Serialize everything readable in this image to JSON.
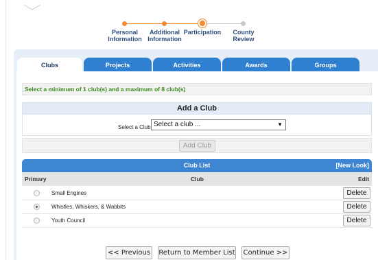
{
  "stepper": {
    "steps": [
      {
        "label_line1": "Personal",
        "label_line2": "Information",
        "state": "done"
      },
      {
        "label_line1": "Additional",
        "label_line2": "Information",
        "state": "done"
      },
      {
        "label_line1": "Participation",
        "label_line2": "",
        "state": "current"
      },
      {
        "label_line1": "County",
        "label_line2": "Review",
        "state": "pending"
      }
    ],
    "colors": {
      "done": "#f28a2e",
      "pending": "#c8c8c8"
    }
  },
  "tabs": [
    {
      "label": "Clubs",
      "active": true
    },
    {
      "label": "Projects",
      "active": false
    },
    {
      "label": "Activities",
      "active": false
    },
    {
      "label": "Awards",
      "active": false
    },
    {
      "label": "Groups",
      "active": false
    }
  ],
  "notice": "Select a minimum of 1 club(s) and a maximum of 8 club(s)",
  "add_club": {
    "title": "Add a Club",
    "select_label": "Select a Club:",
    "select_value": "Select a club ...",
    "button_label": "Add Club"
  },
  "club_list": {
    "title": "Club List",
    "new_look_link": "[New Look]",
    "columns": {
      "primary": "Primary",
      "club": "Club",
      "edit": "Edit"
    },
    "rows": [
      {
        "name": "Small Engines",
        "primary": false,
        "action": "Delete"
      },
      {
        "name": "Whistles, Whiskers, & Wabbits",
        "primary": true,
        "action": "Delete"
      },
      {
        "name": "Youth Council",
        "primary": false,
        "action": "Delete"
      }
    ]
  },
  "footer": {
    "previous": "<< Previous",
    "return": "Return to Member List",
    "continue": "Continue >>"
  },
  "colors": {
    "accent": "#2f80d1",
    "notice_text": "#3a8a1a"
  }
}
